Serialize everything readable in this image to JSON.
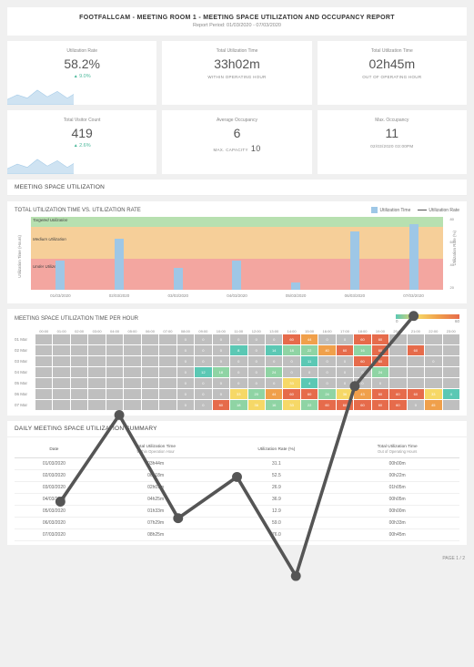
{
  "header": {
    "title": "FOOTFALLCAM - MEETING ROOM 1 - MEETING SPACE UTILIZATION AND OCCUPANCY REPORT",
    "period": "Report Period: 01/03/2020 - 07/03/2020"
  },
  "cards": [
    {
      "label": "Utilization Rate",
      "value": "58.2%",
      "delta": "9.0%",
      "spark": true
    },
    {
      "label": "Total Utilization Time",
      "value": "33h02m",
      "note": "WITHIN OPERATING HOUR"
    },
    {
      "label": "Total Utilization Time",
      "value": "02h45m",
      "note": "OUT OF OPERATING HOUR"
    },
    {
      "label": "Total Visitor Count",
      "value": "419",
      "delta": "2.6%",
      "spark": true
    },
    {
      "label": "Average Occupancy",
      "value": "6",
      "note": "MAX. CAPACITY",
      "extra": "10"
    },
    {
      "label": "Max. Occupancy",
      "value": "11",
      "note": "02/03/2020 03:00PM"
    }
  ],
  "section1": "MEETING SPACE UTILIZATION",
  "combo": {
    "title": "TOTAL UTILIZATION TIME VS. UTILIZATION RATE",
    "legend": {
      "bar": "Utilization Time",
      "line": "Utilization Rate"
    },
    "ylab_left": "Utilization Time (Hours)",
    "ylab_right": "Utilization Rate (%)",
    "bands": {
      "green": "Targeted Utilization",
      "orange": "Medium Utilization",
      "red": "Under Utilized"
    },
    "yticks_right": [
      "80",
      "60",
      "40",
      "20"
    ]
  },
  "chart_data": {
    "type": "bar+line",
    "categories": [
      "01/03/2020",
      "02/03/2020",
      "03/03/2020",
      "04/03/2020",
      "05/03/2020",
      "06/03/2020",
      "07/03/2020"
    ],
    "series": [
      {
        "name": "Utilization Time (h)",
        "type": "bar",
        "values": [
          4,
          7,
          3,
          4,
          1,
          8,
          9
        ]
      },
      {
        "name": "Utilization Rate (%)",
        "type": "line",
        "values": [
          31,
          52,
          27,
          37,
          13,
          59,
          76
        ]
      }
    ],
    "ylim_left": [
      0,
      10
    ],
    "ylim_right": [
      0,
      100
    ],
    "bands": [
      {
        "label": "Targeted Utilization",
        "range": [
          70,
          100
        ],
        "color": "#b7e0b0"
      },
      {
        "label": "Medium Utilization",
        "range": [
          30,
          70
        ],
        "color": "#f6cf99"
      },
      {
        "label": "Under Utilized",
        "range": [
          0,
          30
        ],
        "color": "#f3a6a0"
      }
    ]
  },
  "heat": {
    "title": "MEETING SPACE UTILIZATION TIME PER HOUR",
    "scale": {
      "min": "0",
      "max": "60"
    },
    "hours": [
      "00:00",
      "01:00",
      "02:00",
      "03:00",
      "04:00",
      "05:00",
      "06:00",
      "07:00",
      "08:00",
      "09:00",
      "10:00",
      "11:00",
      "12:00",
      "13:00",
      "14:00",
      "15:00",
      "16:00",
      "17:00",
      "18:00",
      "19:00",
      "20:00",
      "21:00",
      "22:00",
      "23:00"
    ],
    "days": [
      "01 Mar",
      "02 Mar",
      "03 Mar",
      "04 Mar",
      "05 Mar",
      "06 Mar",
      "07 Mar"
    ],
    "grid": [
      [
        null,
        null,
        null,
        null,
        null,
        null,
        null,
        null,
        0,
        0,
        0,
        0,
        0,
        0,
        60,
        44,
        0,
        0,
        60,
        60,
        null,
        null,
        null,
        null
      ],
      [
        null,
        null,
        null,
        null,
        null,
        null,
        null,
        null,
        0,
        0,
        0,
        8,
        0,
        14,
        18,
        22,
        40,
        60,
        16,
        60,
        null,
        60,
        null,
        null
      ],
      [
        null,
        null,
        null,
        null,
        null,
        null,
        null,
        null,
        0,
        0,
        0,
        0,
        0,
        0,
        0,
        11,
        0,
        0,
        60,
        60,
        null,
        null,
        0,
        null
      ],
      [
        null,
        null,
        null,
        null,
        null,
        null,
        null,
        null,
        0,
        12,
        18,
        0,
        0,
        24,
        0,
        0,
        0,
        0,
        0,
        24,
        null,
        null,
        null,
        null
      ],
      [
        null,
        null,
        null,
        null,
        null,
        null,
        null,
        null,
        0,
        0,
        0,
        0,
        0,
        0,
        33,
        4,
        0,
        0,
        0,
        0,
        null,
        null,
        null,
        null
      ],
      [
        null,
        null,
        null,
        null,
        null,
        null,
        null,
        null,
        0,
        0,
        0,
        33,
        20,
        44,
        60,
        60,
        24,
        36,
        43,
        60,
        60,
        60,
        33,
        4
      ],
      [
        null,
        null,
        null,
        null,
        null,
        null,
        null,
        null,
        0,
        0,
        60,
        18,
        36,
        16,
        33,
        22,
        60,
        60,
        60,
        60,
        60,
        0,
        45,
        null
      ]
    ]
  },
  "summary": {
    "title": "DAILY MEETING SPACE UTILIZATION SUMMARY",
    "cols": [
      "Date",
      "Total Utilization Time",
      "Utilization Rate (%)",
      "Total Utilization Time"
    ],
    "subcols": [
      "",
      "Within Operation Hour",
      "",
      "Out of Operating Hours"
    ],
    "rows": [
      [
        "01/03/2020",
        "03h44m",
        "31.1",
        "00h00m"
      ],
      [
        "02/03/2020",
        "06h18m",
        "52.5",
        "00h22m"
      ],
      [
        "03/03/2020",
        "02h01m",
        "26.9",
        "01h05m"
      ],
      [
        "04/03/2020",
        "04h25m",
        "36.9",
        "00h05m"
      ],
      [
        "05/03/2020",
        "01h33m",
        "12.9",
        "00h00m"
      ],
      [
        "06/03/2020",
        "07h29m",
        "59.0",
        "00h33m"
      ],
      [
        "07/03/2020",
        "08h25m",
        "76.0",
        "00h45m"
      ]
    ]
  },
  "footer": "PAGE 1 / 2"
}
